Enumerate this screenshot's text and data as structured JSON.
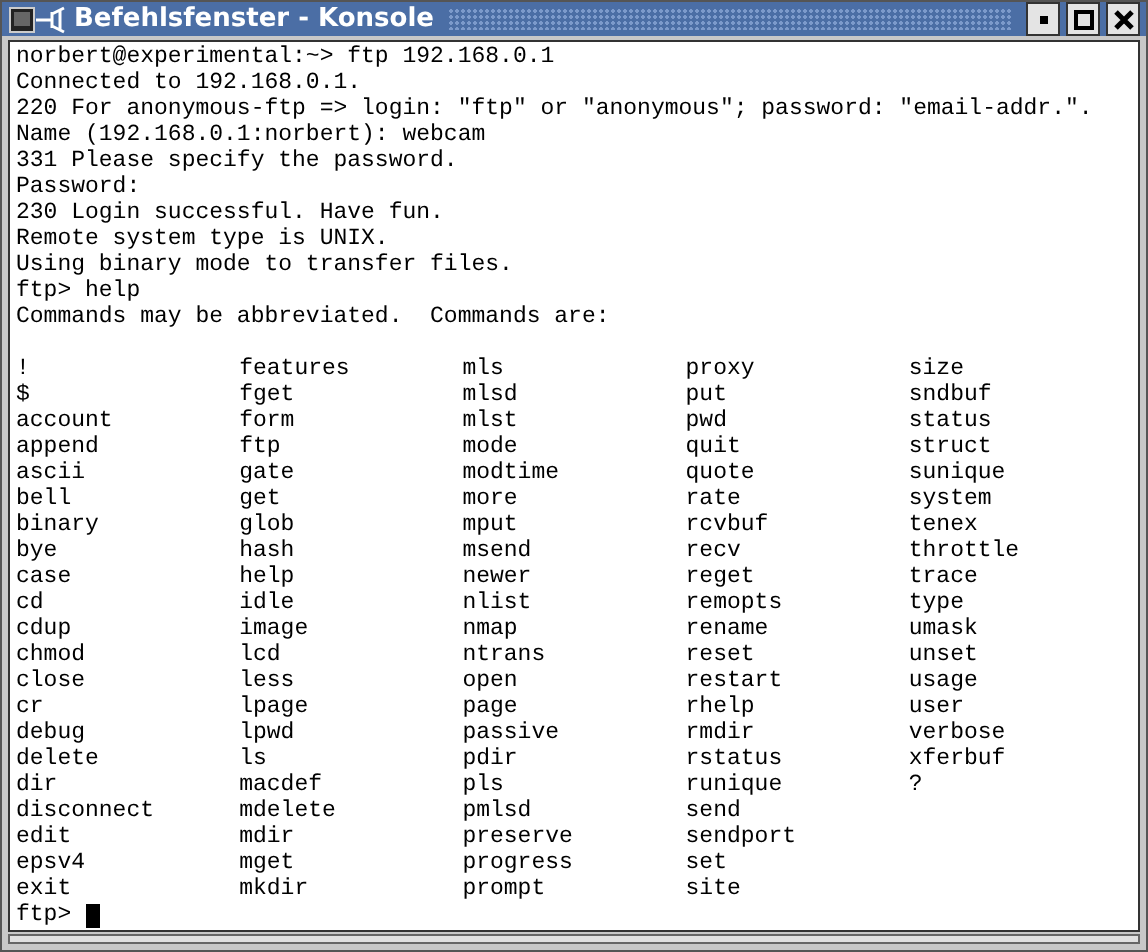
{
  "window": {
    "title": "Befehlsfenster - Konsole"
  },
  "output_lines": [
    "norbert@experimental:~> ftp 192.168.0.1",
    "Connected to 192.168.0.1.",
    "220 For anonymous-ftp => login: \"ftp\" or \"anonymous\"; password: \"email-addr.\".",
    "Name (192.168.0.1:norbert): webcam",
    "331 Please specify the password.",
    "Password:",
    "230 Login successful. Have fun.",
    "Remote system type is UNIX.",
    "Using binary mode to transfer files.",
    "ftp> help",
    "Commands may be abbreviated.  Commands are:"
  ],
  "command_columns": [
    [
      "!",
      "$",
      "account",
      "append",
      "ascii",
      "bell",
      "binary",
      "bye",
      "case",
      "cd",
      "cdup",
      "chmod",
      "close",
      "cr",
      "debug",
      "delete",
      "dir",
      "disconnect",
      "edit",
      "epsv4",
      "exit"
    ],
    [
      "features",
      "fget",
      "form",
      "ftp",
      "gate",
      "get",
      "glob",
      "hash",
      "help",
      "idle",
      "image",
      "lcd",
      "less",
      "lpage",
      "lpwd",
      "ls",
      "macdef",
      "mdelete",
      "mdir",
      "mget",
      "mkdir"
    ],
    [
      "mls",
      "mlsd",
      "mlst",
      "mode",
      "modtime",
      "more",
      "mput",
      "msend",
      "newer",
      "nlist",
      "nmap",
      "ntrans",
      "open",
      "page",
      "passive",
      "pdir",
      "pls",
      "pmlsd",
      "preserve",
      "progress",
      "prompt"
    ],
    [
      "proxy",
      "put",
      "pwd",
      "quit",
      "quote",
      "rate",
      "rcvbuf",
      "recv",
      "reget",
      "remopts",
      "rename",
      "reset",
      "restart",
      "rhelp",
      "rmdir",
      "rstatus",
      "runique",
      "send",
      "sendport",
      "set",
      "site"
    ],
    [
      "size",
      "sndbuf",
      "status",
      "struct",
      "sunique",
      "system",
      "tenex",
      "throttle",
      "trace",
      "type",
      "umask",
      "unset",
      "usage",
      "user",
      "verbose",
      "xferbuf",
      "?"
    ]
  ],
  "prompt": "ftp>"
}
